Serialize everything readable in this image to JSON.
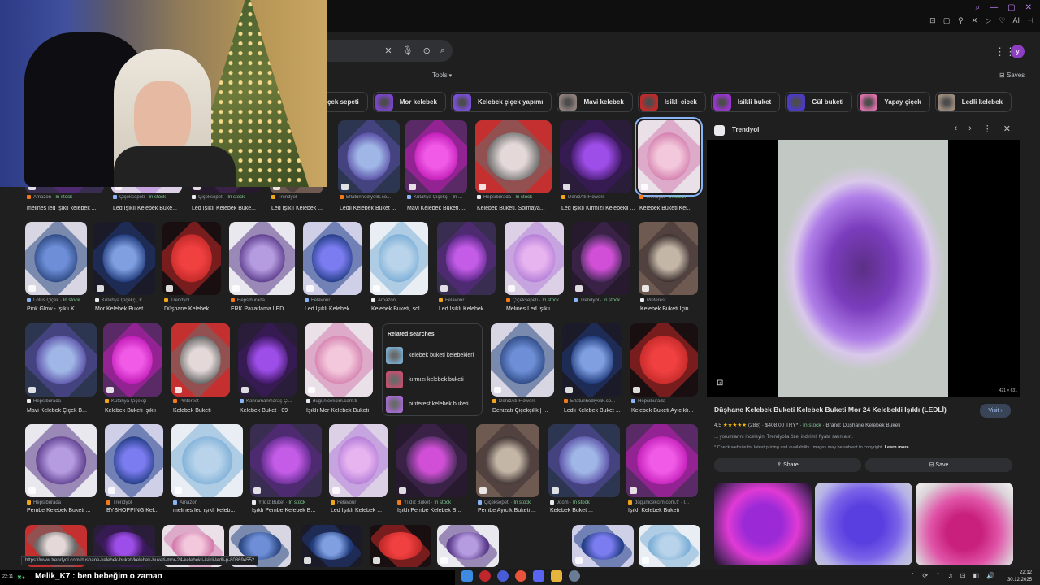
{
  "browser": {
    "window_controls": [
      "⌕",
      "—",
      "▢",
      "✕"
    ],
    "extensions": [
      "⊡",
      "▢",
      "⚲",
      "✕",
      "▷",
      "♡",
      "AI",
      "⊣"
    ]
  },
  "search": {
    "placeholder": ""
  },
  "header": {
    "tools_label": "Tools",
    "saves_label": "Saves",
    "avatar_letter": "y"
  },
  "chips": [
    {
      "label": "çek sepeti",
      "color": "#d6c7b0"
    },
    {
      "label": "Mor kelebek",
      "color": "#7b45c9"
    },
    {
      "label": "Kelebek çiçek yapımı",
      "color": "#7a4fd6"
    },
    {
      "label": "Mavi kelebek",
      "color": "#8c7e7a"
    },
    {
      "label": "Isikli cicek",
      "color": "#c22a2a"
    },
    {
      "label": "Isikli buket",
      "color": "#9a35d0"
    },
    {
      "label": "Gül buketi",
      "color": "#4c3ac9"
    },
    {
      "label": "Yapay çiçek",
      "color": "#d86fa6"
    },
    {
      "label": "Ledli kelebek",
      "color": "#9a8a7c"
    }
  ],
  "grid": {
    "rows": [
      [
        {
          "src": "Amazon",
          "stock": "In stock",
          "title": "melines led ışıklı kelebek ..."
        },
        {
          "src": "Çiçeksepeti",
          "stock": "In stock",
          "title": "Led Işıklı Kelebek Buke..."
        },
        {
          "src": "Çiçeksepeti",
          "stock": "In stock",
          "title": "Led Işıklı Kelebek Buke..."
        },
        {
          "src": "Trendyol",
          "stock": "",
          "title": "Led Işıklı Kelebek ..."
        },
        {
          "src": "Eflatunhediyelik.co...",
          "stock": "",
          "title": "Ledli Kelebek Buket ..."
        },
        {
          "src": "Kütahya Çiçekçi · In ...",
          "stock": "",
          "title": "Mavi Kelebek Buketi, ..."
        },
        {
          "src": "Hepsiburada",
          "stock": "In stock",
          "title": "Kelebek Buketi, Solmaya..."
        },
        {
          "src": "DenizAtı Flowers",
          "stock": "",
          "title": "Led Işıklı Kırmızı Kelebekli ..."
        },
        {
          "src": "Trendyol",
          "stock": "In stock",
          "title": "Kelebek Buketi Kel..."
        }
      ],
      [
        {
          "src": "Lotus Çiçek",
          "stock": "In stock",
          "title": "Pink Glow - Işıklı K..."
        },
        {
          "src": "Kütahya Çiçekçi, K...",
          "stock": "",
          "title": "Mor Kelebek Buket..."
        },
        {
          "src": "Trendyol",
          "stock": "",
          "title": "Düşhane Kelebek ..."
        },
        {
          "src": "Hepsiburada",
          "stock": "",
          "title": "ERK Pazarlama LED ..."
        },
        {
          "src": "Felavour",
          "stock": "",
          "title": "Led Işıklı Kelebek ..."
        },
        {
          "src": "Amazon",
          "stock": "",
          "title": "Kelebek Buketi, sol..."
        },
        {
          "src": "Felavour",
          "stock": "",
          "title": "Led Işıklı Kelebek ..."
        },
        {
          "src": "Çiçeksepeti",
          "stock": "In stock",
          "title": "Melines Led Işıklı ..."
        },
        {
          "src": "Trendyol",
          "stock": "In stock",
          "title": ""
        },
        {
          "src": "Pinterest",
          "stock": "",
          "title": "Kelebek Buketi İçin..."
        }
      ],
      [
        {
          "src": "Hepsiburada",
          "stock": "",
          "title": "Mavi Kelebek Çiçek B..."
        },
        {
          "src": "Kütahya Çiçekçi",
          "stock": "",
          "title": "Kelebek Buketi Işıklı"
        },
        {
          "src": "Pinterest",
          "stock": "",
          "title": "Kelebek Buketi"
        },
        {
          "src": "Kahramanmaraş Çi...",
          "stock": "",
          "title": "Kelebek Buket - 09"
        },
        {
          "src": "dugunicekcim.com.tr",
          "stock": "",
          "title": "Işıklı Mor Kelebek Buketi"
        },
        {
          "src": "DenizAtı Flowers",
          "stock": "",
          "title": "Denizatı Çiçekçilik | ..."
        },
        {
          "src": "Eflatunhediyelik.co...",
          "stock": "",
          "title": "Ledli Kelebek Buket ..."
        },
        {
          "src": "Hepsiburada",
          "stock": "",
          "title": "Kelebek Buketi Ayıcıklı..."
        }
      ],
      [
        {
          "src": "Hepsiburada",
          "stock": "",
          "title": "Pembe Kelebek Buketi ..."
        },
        {
          "src": "Trendyol",
          "stock": "",
          "title": "BYSHOPPİNG Kel..."
        },
        {
          "src": "Amazon",
          "stock": "",
          "title": "melines led ışıklı keleb..."
        },
        {
          "src": "Yıldız Buket",
          "stock": "In stock",
          "title": "Işıklı Pembe Kelebek B..."
        },
        {
          "src": "Felavour",
          "stock": "",
          "title": "Led Işıklı Kelebek ..."
        },
        {
          "src": "Yıldız Buket",
          "stock": "In stock",
          "title": "Işıklı Pembe Kelebek B..."
        },
        {
          "src": "Çiçeksepeti",
          "stock": "In stock",
          "title": "Pembe Ayıcık Buketi ..."
        },
        {
          "src": "Joom",
          "stock": "In stock",
          "title": "Kelebek Buket ..."
        },
        {
          "src": "dugunicekcim.com.tr · I...",
          "stock": "",
          "title": "Işıklı Kelebek Buketi"
        }
      ]
    ]
  },
  "related_searches": {
    "title": "Related searches",
    "items": [
      {
        "label": "kelebek buketi kelebekleri",
        "color": "#79a9c9"
      },
      {
        "label": "kırmızı kelebek buketi",
        "color": "#c4506f"
      },
      {
        "label": "pinterest kelebek buketi",
        "color": "#a56bd0"
      }
    ]
  },
  "preview": {
    "source": "Trendyol",
    "nav": [
      "‹",
      "›",
      "⋮",
      "✕"
    ],
    "image_size": "421 × 631",
    "title": "Düşhane Kelebek Buketi Kelebek Buketi Mor 24 Kelebekli Işıklı (LEDLİ)",
    "visit_label": "Visit ›",
    "rating": "4.5",
    "stars": "★★★★★",
    "reviews": "(288)",
    "price": "$408.00 TRY*",
    "stock": "In stock",
    "brand": "Brand: Düşhane Kelebek Buketi",
    "description": "... yorumlarını inceleyin, Trendyol'a özel indirimli fiyata satın alın.",
    "note": "* Check website for latest pricing and availability. Images may be subject to copyright.",
    "learn_more": "Learn more",
    "share_label": "Share",
    "save_label": "Save"
  },
  "status_url": "https://www.trendyol.com/dushane-kelebek-buketi/kelebek-buketi-mor-24-kelebekli-isikli-ledli-p-808694552",
  "chat": {
    "time": "22:11",
    "message": "Melik_K7 : ben bebeğim o zaman"
  },
  "taskbar": {
    "time": "22:12",
    "date": "30.12.2025",
    "tray": [
      "⌃",
      "⟳",
      "⇡",
      "♫",
      "⊡",
      "◧",
      "🔊"
    ]
  }
}
